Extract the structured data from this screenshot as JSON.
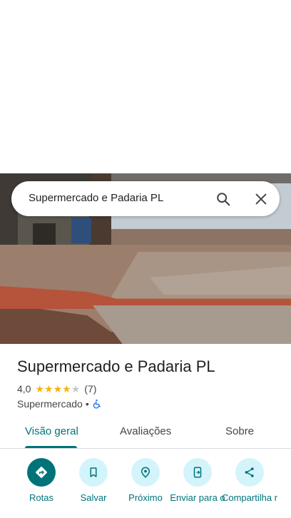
{
  "search": {
    "query": "Supermercado e Padaria PL",
    "search_icon": "search-icon",
    "clear_icon": "close-icon"
  },
  "place": {
    "name": "Supermercado e Padaria PL",
    "rating": "4,0",
    "stars": 4,
    "star_total": 5,
    "review_count": "(7)",
    "category": "Supermercado",
    "separator": "•",
    "accessibility_icon": "wheelchair-icon"
  },
  "tabs": [
    {
      "label": "Visão geral",
      "active": true
    },
    {
      "label": "Avaliações",
      "active": false
    },
    {
      "label": "Sobre",
      "active": false
    }
  ],
  "actions": [
    {
      "label": "Rotas",
      "icon": "directions-icon"
    },
    {
      "label": "Salvar",
      "icon": "bookmark-icon"
    },
    {
      "label": "Próximo",
      "icon": "nearby-icon"
    },
    {
      "label": "Enviar para o",
      "icon": "send-to-phone-icon"
    },
    {
      "label": "Compartilha r",
      "icon": "share-icon"
    }
  ],
  "colors": {
    "accent": "#00737a",
    "action_bg": "#d3f4fb",
    "star": "#f6b30e"
  }
}
